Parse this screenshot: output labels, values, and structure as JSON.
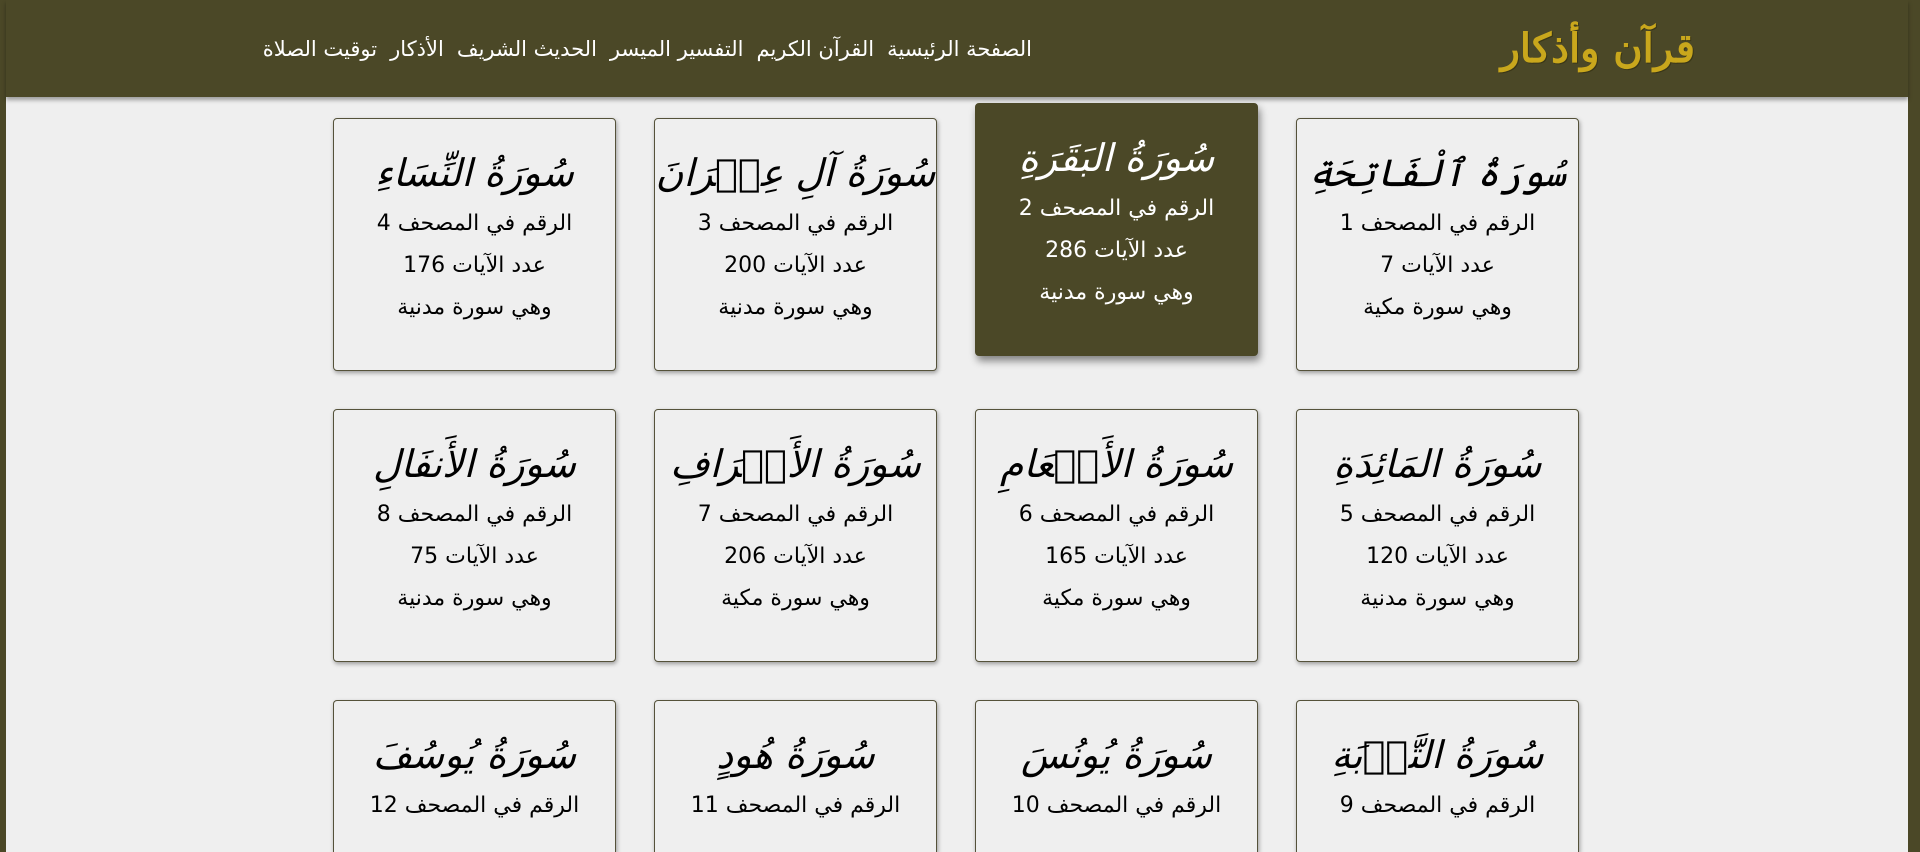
{
  "brand": {
    "logo_text": "قرآن وأذكار"
  },
  "nav": {
    "items": [
      {
        "label": "الصفحة الرئيسية"
      },
      {
        "label": "القرآن الكريم"
      },
      {
        "label": "التفسير الميسر"
      },
      {
        "label": "الحديث الشريف"
      },
      {
        "label": "الأذكار"
      },
      {
        "label": "توقيت الصلاة"
      }
    ]
  },
  "surahs": [
    {
      "name": "سُورَةُ ٱلْفَاتِحَةِ",
      "number_text": "الرقم في المصحف 1",
      "verses_text": "عدد الآيات 7",
      "type_text": "وهي سورة مكية"
    },
    {
      "name": "سُورَةُ البَقَرَةِ",
      "number_text": "الرقم في المصحف 2",
      "verses_text": "عدد الآيات 286",
      "type_text": "وهي سورة مدنية"
    },
    {
      "name": "سُورَةُ آلِ عِمۡرَانَ",
      "number_text": "الرقم في المصحف 3",
      "verses_text": "عدد الآيات 200",
      "type_text": "وهي سورة مدنية"
    },
    {
      "name": "سُورَةُ النِّسَاءِ",
      "number_text": "الرقم في المصحف 4",
      "verses_text": "عدد الآيات 176",
      "type_text": "وهي سورة مدنية"
    },
    {
      "name": "سُورَةُ المَائِدَةِ",
      "number_text": "الرقم في المصحف 5",
      "verses_text": "عدد الآيات 120",
      "type_text": "وهي سورة مدنية"
    },
    {
      "name": "سُورَةُ الأَنۡعَامِ",
      "number_text": "الرقم في المصحف 6",
      "verses_text": "عدد الآيات 165",
      "type_text": "وهي سورة مكية"
    },
    {
      "name": "سُورَةُ الأَعۡرَافِ",
      "number_text": "الرقم في المصحف 7",
      "verses_text": "عدد الآيات 206",
      "type_text": "وهي سورة مكية"
    },
    {
      "name": "سُورَةُ الأَنفَالِ",
      "number_text": "الرقم في المصحف 8",
      "verses_text": "عدد الآيات 75",
      "type_text": "وهي سورة مدنية"
    },
    {
      "name": "سُورَةُ التَّوۡبَةِ",
      "number_text": "الرقم في المصحف 9"
    },
    {
      "name": "سُورَةُ يُونُسَ",
      "number_text": "الرقم في المصحف 10"
    },
    {
      "name": "سُورَةُ هُودٍ",
      "number_text": "الرقم في المصحف 11"
    },
    {
      "name": "سُورَةُ يُوسُفَ",
      "number_text": "الرقم في المصحف 12"
    }
  ],
  "colors": {
    "accent": "#4b4827",
    "logo": "#c9a71c",
    "card_bg": "#efefef"
  }
}
